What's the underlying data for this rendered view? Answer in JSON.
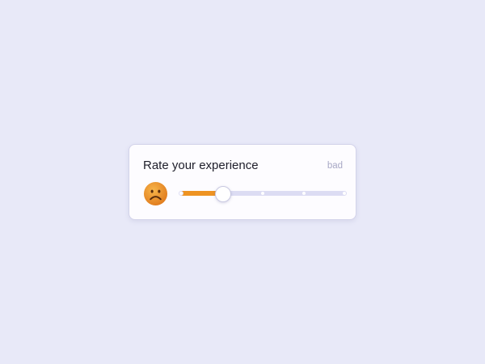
{
  "card": {
    "title": "Rate your experience",
    "rating_label": "bad",
    "emoji_icon": "slightly-frowning-face",
    "slider": {
      "min": 0,
      "max": 4,
      "steps": 5,
      "value": 1
    },
    "accent_color": "#ee9322"
  }
}
